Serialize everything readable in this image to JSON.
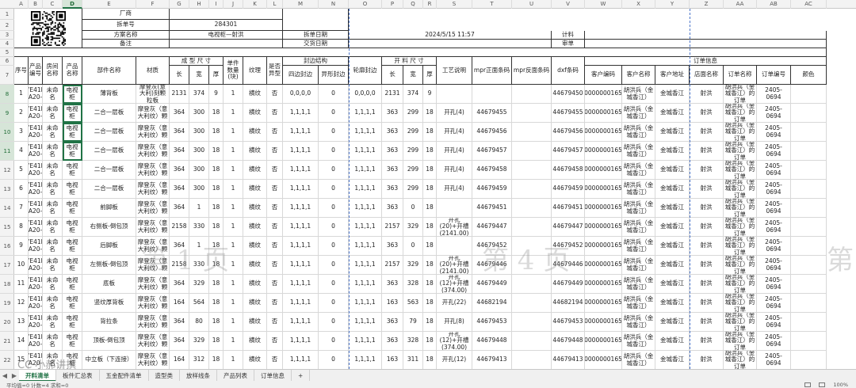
{
  "columns": [
    "A",
    "B",
    "C",
    "D",
    "E",
    "F",
    "G",
    "H",
    "I",
    "J",
    "K",
    "L",
    "M",
    "N",
    "O",
    "P",
    "Q",
    "R",
    "S",
    "T",
    "U",
    "V",
    "W",
    "X",
    "Y",
    "Z",
    "AA",
    "AB",
    "AC"
  ],
  "selected_column": "D",
  "row_numbers": [
    "1",
    "2",
    "3",
    "4",
    "5",
    "6",
    "7",
    "8",
    "9",
    "10",
    "11",
    "12",
    "13",
    "14",
    "15",
    "16",
    "17",
    "18",
    "19",
    "20",
    "21",
    "22"
  ],
  "selected_rows": [
    "8",
    "9",
    "10",
    "11"
  ],
  "top": {
    "factory_label": "厂商",
    "order_no_label": "拆单号",
    "order_no": "284301",
    "scheme_label": "方案名称",
    "scheme": "电视柜—射洪",
    "remark_label": "备注",
    "split_date_label": "拆单日期",
    "split_date": "2024/5/15 11:57",
    "delivery_date_label": "交货日期",
    "plan_label": "计料",
    "review_label": "审单"
  },
  "headers": {
    "seq": "序号",
    "product_no": "产品编号",
    "room": "房间名称",
    "product_name": "产品名称",
    "part_name": "部件名称",
    "material": "材质",
    "finish_size": "成 型 尺 寸",
    "len": "长",
    "wid": "宽",
    "thk": "厚",
    "qty": "单件数量(块)",
    "grain": "纹理",
    "shaped": "是否异型",
    "edge": "封边结构",
    "four_edge": "四边封边",
    "shape_edge": "异形封边",
    "contour_edge": "轮廓封边",
    "cut_size": "开 料 尺 寸",
    "cut_len": "长",
    "cut_wid": "宽",
    "cut_thk": "厚",
    "process": "工艺说明",
    "mpr_front": "mpr正面条码",
    "mpr_back": "mpr反面条码",
    "dxf": "dxf条码",
    "order_info": "订单信息",
    "cust_code": "客户编码",
    "cust_name": "客户名称",
    "cust_addr": "客户地址",
    "store": "店面名称",
    "order_name": "订单名称",
    "order_code": "订单编号",
    "color": "颜色"
  },
  "rows": [
    {
      "row": "8",
      "seq": "1",
      "pno": "7E41E A20-",
      "room": "未命名",
      "prod": "电视柜",
      "part": "薄背板",
      "mat": "摩登灰(意大利)刻颗粒板",
      "l": "2131",
      "w": "374",
      "t": "9",
      "q": "1",
      "grain": "横纹",
      "sh": "否",
      "fe": "0,0,0,0",
      "se": "0",
      "ce": "0,0,0,0",
      "cl": "2131",
      "cw": "374",
      "ct": "9",
      "proc": "",
      "mf": "",
      "mb": "",
      "dxf": "44679450",
      "cc": "0000000165",
      "cn": "胡洪兵（金城香江）",
      "ca": "金城香江",
      "st": "射洪",
      "on": "胡洪兵（金城香江）的订单",
      "oc": "2405-0694"
    },
    {
      "row": "9",
      "seq": "2",
      "pno": "7E41E A20-",
      "room": "未命名",
      "prod": "电视柜",
      "part": "二合一层板",
      "mat": "摩登灰（意大利纹）颗",
      "l": "364",
      "w": "300",
      "t": "18",
      "q": "1",
      "grain": "横纹",
      "sh": "否",
      "fe": "1,1,1,1",
      "se": "0",
      "ce": "1,1,1,1",
      "cl": "363",
      "cw": "299",
      "ct": "18",
      "proc": "开孔(4)",
      "mf": "44679455",
      "mb": "",
      "dxf": "44679455",
      "cc": "0000000165",
      "cn": "胡洪兵（金城香江）",
      "ca": "金城香江",
      "st": "射洪",
      "on": "胡洪兵（金城香江）的订单",
      "oc": "2405-0694"
    },
    {
      "row": "10",
      "seq": "3",
      "pno": "7E41E A20-",
      "room": "未命名",
      "prod": "电视柜",
      "part": "二合一层板",
      "mat": "摩登灰（意大利纹）颗",
      "l": "364",
      "w": "300",
      "t": "18",
      "q": "1",
      "grain": "横纹",
      "sh": "否",
      "fe": "1,1,1,1",
      "se": "0",
      "ce": "1,1,1,1",
      "cl": "363",
      "cw": "299",
      "ct": "18",
      "proc": "开孔(4)",
      "mf": "44679456",
      "mb": "",
      "dxf": "44679456",
      "cc": "0000000165",
      "cn": "胡洪兵（金城香江）",
      "ca": "金城香江",
      "st": "射洪",
      "on": "胡洪兵（金城香江）的订单",
      "oc": "2405-0694"
    },
    {
      "row": "11",
      "seq": "4",
      "pno": "7E41E A20-",
      "room": "未命名",
      "prod": "电视柜",
      "part": "二合一层板",
      "mat": "摩登灰（意大利纹）颗",
      "l": "364",
      "w": "300",
      "t": "18",
      "q": "1",
      "grain": "横纹",
      "sh": "否",
      "fe": "1,1,1,1",
      "se": "0",
      "ce": "1,1,1,1",
      "cl": "363",
      "cw": "299",
      "ct": "18",
      "proc": "开孔(4)",
      "mf": "44679457",
      "mb": "",
      "dxf": "44679457",
      "cc": "0000000165",
      "cn": "胡洪兵（金城香江）",
      "ca": "金城香江",
      "st": "射洪",
      "on": "胡洪兵（金城香江）的订单",
      "oc": "2405-0694"
    },
    {
      "row": "12",
      "seq": "5",
      "pno": "7E41E A20-",
      "room": "未命名",
      "prod": "电视柜",
      "part": "二合一层板",
      "mat": "摩登灰（意大利纹）颗",
      "l": "364",
      "w": "300",
      "t": "18",
      "q": "1",
      "grain": "横纹",
      "sh": "否",
      "fe": "1,1,1,1",
      "se": "0",
      "ce": "1,1,1,1",
      "cl": "363",
      "cw": "299",
      "ct": "18",
      "proc": "开孔(4)",
      "mf": "44679458",
      "mb": "",
      "dxf": "44679458",
      "cc": "0000000165",
      "cn": "胡洪兵（金城香江）",
      "ca": "金城香江",
      "st": "射洪",
      "on": "胡洪兵（金城香江）的订单",
      "oc": "2405-0694"
    },
    {
      "row": "13",
      "seq": "6",
      "pno": "7E41E A20-",
      "room": "未命名",
      "prod": "电视柜",
      "part": "二合一层板",
      "mat": "摩登灰（意大利纹）颗",
      "l": "364",
      "w": "300",
      "t": "18",
      "q": "1",
      "grain": "横纹",
      "sh": "否",
      "fe": "1,1,1,1",
      "se": "0",
      "ce": "1,1,1,1",
      "cl": "363",
      "cw": "299",
      "ct": "18",
      "proc": "开孔(4)",
      "mf": "44679459",
      "mb": "",
      "dxf": "44679459",
      "cc": "0000000165",
      "cn": "胡洪兵（金城香江）",
      "ca": "金城香江",
      "st": "射洪",
      "on": "胡洪兵（金城香江）的订单",
      "oc": "2405-0694"
    },
    {
      "row": "14",
      "seq": "7",
      "pno": "7E41E A20-",
      "room": "未命名",
      "prod": "电视柜",
      "part": "前脚板",
      "mat": "摩登灰（意大利纹）颗",
      "l": "364",
      "w": "1",
      "t": "18",
      "q": "1",
      "grain": "横纹",
      "sh": "否",
      "fe": "1,1,1,1",
      "se": "0",
      "ce": "1,1,1,1",
      "cl": "363",
      "cw": "0",
      "ct": "18",
      "proc": "",
      "mf": "44679451",
      "mb": "",
      "dxf": "44679451",
      "cc": "0000000165",
      "cn": "胡洪兵（金城香江）",
      "ca": "金城香江",
      "st": "射洪",
      "on": "胡洪兵（金城香江）的订单",
      "oc": "2405-0694"
    },
    {
      "row": "15",
      "seq": "8",
      "pno": "7E41E A20-",
      "room": "未命名",
      "prod": "电视柜",
      "part": "右侧板-倒包顶",
      "mat": "摩登灰（意大利纹）颗",
      "l": "2158",
      "w": "330",
      "t": "18",
      "q": "1",
      "grain": "横纹",
      "sh": "否",
      "fe": "1,1,1,1",
      "se": "0",
      "ce": "1,1,1,1",
      "cl": "2157",
      "cw": "329",
      "ct": "18",
      "proc": "开孔(20)+开槽(2141.00)",
      "mf": "44679447",
      "mb": "",
      "dxf": "44679447",
      "cc": "0000000165",
      "cn": "胡洪兵（金城香江）",
      "ca": "金城香江",
      "st": "射洪",
      "on": "胡洪兵（金城香江）的订单",
      "oc": "2405-0694"
    },
    {
      "row": "16",
      "seq": "9",
      "pno": "7E41E A20-",
      "room": "未命名",
      "prod": "电视柜",
      "part": "后脚板",
      "mat": "摩登灰（意大利纹）颗",
      "l": "364",
      "w": "1",
      "t": "18",
      "q": "1",
      "grain": "横纹",
      "sh": "否",
      "fe": "1,1,1,1",
      "se": "0",
      "ce": "1,1,1,1",
      "cl": "363",
      "cw": "0",
      "ct": "18",
      "proc": "",
      "mf": "44679452",
      "mb": "",
      "dxf": "44679452",
      "cc": "0000000165",
      "cn": "胡洪兵（金城香江）",
      "ca": "金城香江",
      "st": "射洪",
      "on": "胡洪兵（金城香江）的订单",
      "oc": "2405-0694"
    },
    {
      "row": "17",
      "seq": "10",
      "pno": "7E41E A20-",
      "room": "未命名",
      "prod": "电视柜",
      "part": "左侧板-倒包顶",
      "mat": "摩登灰（意大利纹）颗",
      "l": "2158",
      "w": "330",
      "t": "18",
      "q": "1",
      "grain": "横纹",
      "sh": "否",
      "fe": "1,1,1,1",
      "se": "0",
      "ce": "1,1,1,1",
      "cl": "2157",
      "cw": "329",
      "ct": "18",
      "proc": "开孔(20)+开槽(2141.00)",
      "mf": "44679446",
      "mb": "",
      "dxf": "44679446",
      "cc": "0000000165",
      "cn": "胡洪兵（金城香江）",
      "ca": "金城香江",
      "st": "射洪",
      "on": "胡洪兵（金城香江）的订单",
      "oc": "2405-0694"
    },
    {
      "row": "18",
      "seq": "11",
      "pno": "7E41E A20-",
      "room": "未命名",
      "prod": "电视柜",
      "part": "底板",
      "mat": "摩登灰（意大利纹）颗",
      "l": "364",
      "w": "329",
      "t": "18",
      "q": "1",
      "grain": "横纹",
      "sh": "否",
      "fe": "1,1,1,1",
      "se": "0",
      "ce": "1,1,1,1",
      "cl": "363",
      "cw": "328",
      "ct": "18",
      "proc": "开孔(12)+开槽(374.00)",
      "mf": "44679449",
      "mb": "",
      "dxf": "44679449",
      "cc": "0000000165",
      "cn": "胡洪兵（金城香江）",
      "ca": "金城香江",
      "st": "射洪",
      "on": "胡洪兵（金城香江）的订单",
      "oc": "2405-0694"
    },
    {
      "row": "19",
      "seq": "12",
      "pno": "7E41E A20-",
      "room": "未命名",
      "prod": "电视柜",
      "part": "竖纹厚背板",
      "mat": "摩登灰（意大利纹）颗",
      "l": "164",
      "w": "564",
      "t": "18",
      "q": "1",
      "grain": "横纹",
      "sh": "否",
      "fe": "1,1,1,1",
      "se": "0",
      "ce": "1,1,1,1",
      "cl": "163",
      "cw": "563",
      "ct": "18",
      "proc": "开孔(22)",
      "mf": "44682194",
      "mb": "",
      "dxf": "44682194",
      "cc": "0000000165",
      "cn": "胡洪兵（金城香江）",
      "ca": "金城香江",
      "st": "射洪",
      "on": "胡洪兵（金城香江）的订单",
      "oc": "2405-0694"
    },
    {
      "row": "20",
      "seq": "13",
      "pno": "7E41E A20-",
      "room": "未命名",
      "prod": "电视柜",
      "part": "背拉条",
      "mat": "摩登灰（意大利纹）颗",
      "l": "364",
      "w": "80",
      "t": "18",
      "q": "1",
      "grain": "横纹",
      "sh": "否",
      "fe": "1,1,1,1",
      "se": "0",
      "ce": "1,1,1,1",
      "cl": "363",
      "cw": "79",
      "ct": "18",
      "proc": "开孔(8)",
      "mf": "44679453",
      "mb": "",
      "dxf": "44679453",
      "cc": "0000000165",
      "cn": "胡洪兵（金城香江）",
      "ca": "金城香江",
      "st": "射洪",
      "on": "胡洪兵（金城香江）的订单",
      "oc": "2405-0694"
    },
    {
      "row": "21",
      "seq": "14",
      "pno": "7E41E A20-",
      "room": "未命名",
      "prod": "电视柜",
      "part": "顶板-倒包顶",
      "mat": "摩登灰（意大利纹）颗",
      "l": "364",
      "w": "329",
      "t": "18",
      "q": "1",
      "grain": "横纹",
      "sh": "否",
      "fe": "1,1,1,1",
      "se": "0",
      "ce": "1,1,1,1",
      "cl": "363",
      "cw": "328",
      "ct": "18",
      "proc": "开孔(12)+开槽(374.00)",
      "mf": "44679448",
      "mb": "",
      "dxf": "44679448",
      "cc": "0000000165",
      "cn": "胡洪兵（金城香江）",
      "ca": "金城香江",
      "st": "射洪",
      "on": "胡洪兵（金城香江）的订单",
      "oc": "2405-0694"
    },
    {
      "row": "22",
      "seq": "15",
      "pno": "7E41E A20-",
      "room": "未命名",
      "prod": "电视柜",
      "part": "中立板（下连接）",
      "mat": "摩登灰（意大利纹）颗",
      "l": "164",
      "w": "312",
      "t": "18",
      "q": "1",
      "grain": "横纹",
      "sh": "否",
      "fe": "1,1,1,1",
      "se": "0",
      "ce": "1,1,1,1",
      "cl": "163",
      "cw": "311",
      "ct": "18",
      "proc": "开孔(12)",
      "mf": "44679413",
      "mb": "",
      "dxf": "44679413",
      "cc": "0000000165",
      "cn": "胡洪兵（金城香江）",
      "ca": "金城香江",
      "st": "射洪",
      "on": "胡洪兵（金城香江）的订单",
      "oc": "2405-0694"
    }
  ],
  "watermarks": [
    "第 1 页",
    "第 4 页",
    "第"
  ],
  "tabs": [
    "开料清单",
    "板件汇总表",
    "五金配件清单",
    "造型类",
    "放样线条",
    "产品列表",
    "订单信息"
  ],
  "active_tab": "开料清单",
  "add_tab": "+",
  "status_left": "平均值=0  计数=4  求和=0",
  "zoom": "100%",
  "brand": "CC 小郝讲撰",
  "colors": {
    "accent": "#217346",
    "page_break": "#4a74c9"
  }
}
